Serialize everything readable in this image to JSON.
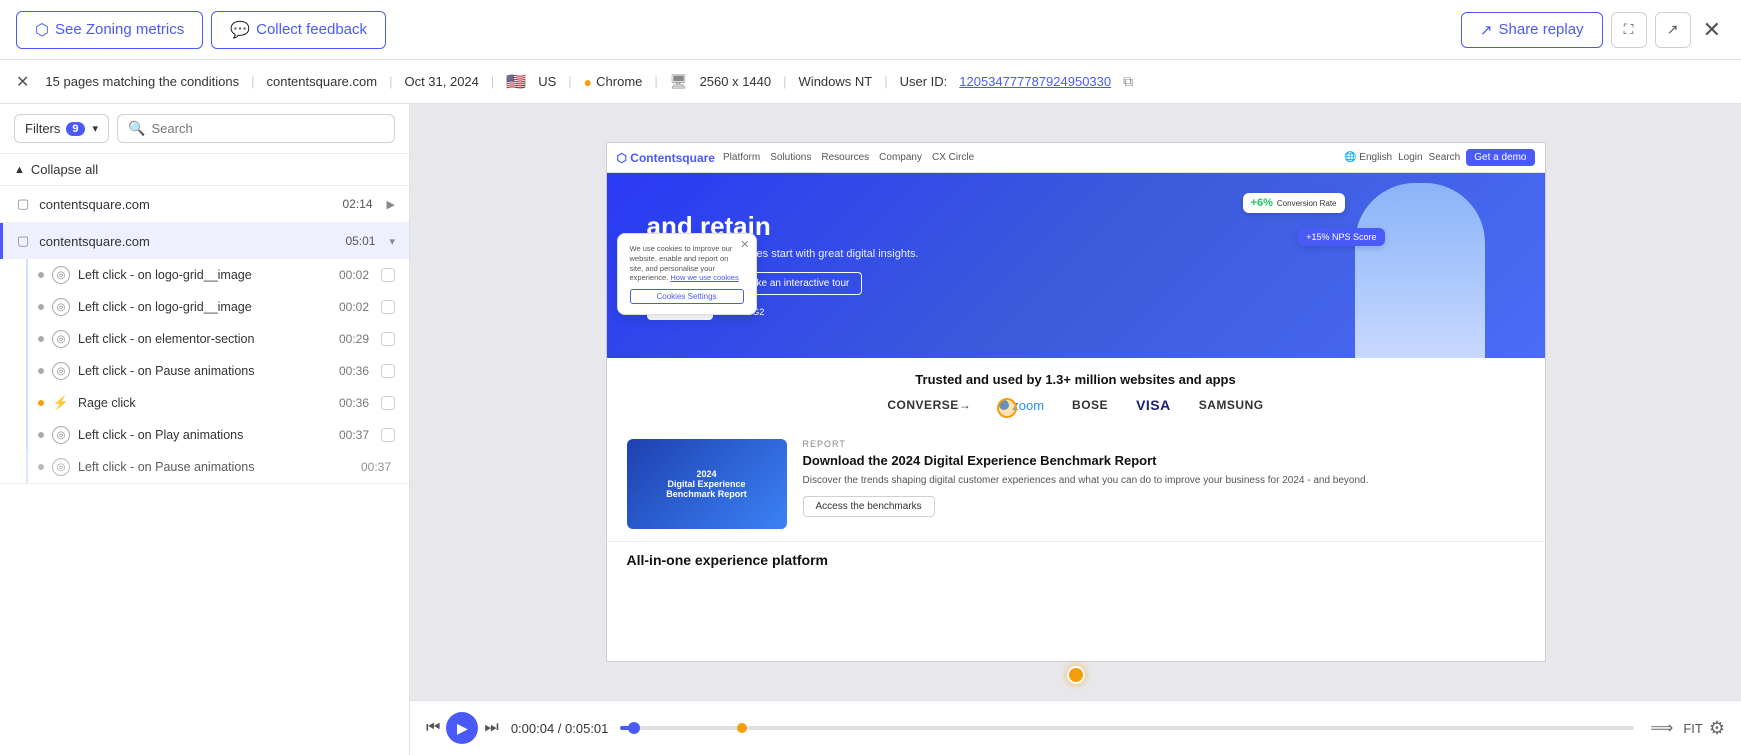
{
  "topBar": {
    "zoningMetrics": "See Zoning metrics",
    "collectFeedback": "Collect feedback",
    "shareReplay": "Share replay"
  },
  "metaBar": {
    "pagesText": "15 pages matching the conditions",
    "domain": "contentsquare.com",
    "date": "Oct 31, 2024",
    "country": "US",
    "browser": "Chrome",
    "resolution": "2560 x 1440",
    "os": "Windows NT",
    "userIdLabel": "User ID:",
    "userId": "120534777787924950330"
  },
  "filters": {
    "label": "Filters",
    "count": "9",
    "searchPlaceholder": "Search"
  },
  "sessions": {
    "collapseAll": "Collapse all",
    "group1": {
      "name": "contentsquare.com",
      "time": "02:14",
      "expanded": false
    },
    "group2": {
      "name": "contentsquare.com",
      "time": "05:01",
      "expanded": true,
      "events": [
        {
          "type": "click",
          "label": "Left click - on logo-grid__image",
          "time": "00:02"
        },
        {
          "type": "click",
          "label": "Left click - on logo-grid__image",
          "time": "00:02"
        },
        {
          "type": "click",
          "label": "Left click - on elementor-section",
          "time": "00:29"
        },
        {
          "type": "click",
          "label": "Left click - on Pause animations",
          "time": "00:36"
        },
        {
          "type": "rage",
          "label": "Rage click",
          "time": "00:36"
        },
        {
          "type": "click",
          "label": "Left click - on Play animations",
          "time": "00:37"
        },
        {
          "type": "click",
          "label": "Left click - on Pause animations",
          "time": "00:37"
        }
      ]
    }
  },
  "replay": {
    "nav": {
      "logo": "Contentsquare",
      "links": [
        "Platform",
        "Solutions",
        "Resources",
        "Company",
        "CX Circle"
      ],
      "rightLinks": [
        "English",
        "Login",
        "Search"
      ],
      "ctaLabel": "Get a demo"
    },
    "hero": {
      "titleLine1": "and retain",
      "subtitle": "Great digital experiences start with great digital insights.",
      "btn1": "Get a demo",
      "btn2": "Take an interactive tour",
      "badgeGreen": "+6% Conversion Rate",
      "badgeBlue": "+15% NPS Score",
      "g2Rating": "4.7/5 on G2"
    },
    "trusted": {
      "title": "Trusted and used by 1.3+ million websites and apps",
      "logos": [
        "CONVERSE→",
        "zoom",
        "BOSE",
        "VISA",
        "SAMSUNG"
      ]
    },
    "report": {
      "tag": "REPORT",
      "title": "Download the 2024 Digital Experience Benchmark Report",
      "desc": "Discover the trends shaping digital customer experiences and what you can do to improve your business for 2024 - and beyond.",
      "cta": "Access the benchmarks",
      "imgLabel": "2024\nDigital Experience\nBenchmark Report"
    },
    "allInOne": {
      "title": "All-in-one experience platform"
    },
    "cookie": {
      "text": "We use cookies to improve our website, enable and report on site, and personalise your experience.",
      "linkText": "How we use cookies",
      "btnLabel": "Cookies Settings"
    }
  },
  "playback": {
    "currentTime": "0:00:04",
    "totalTime": "0:05:01",
    "timeDisplay": "0:00:04 / 0:05:01",
    "progressPercent": 1.3,
    "markerPercent": 12,
    "fitLabel": "FIT"
  }
}
